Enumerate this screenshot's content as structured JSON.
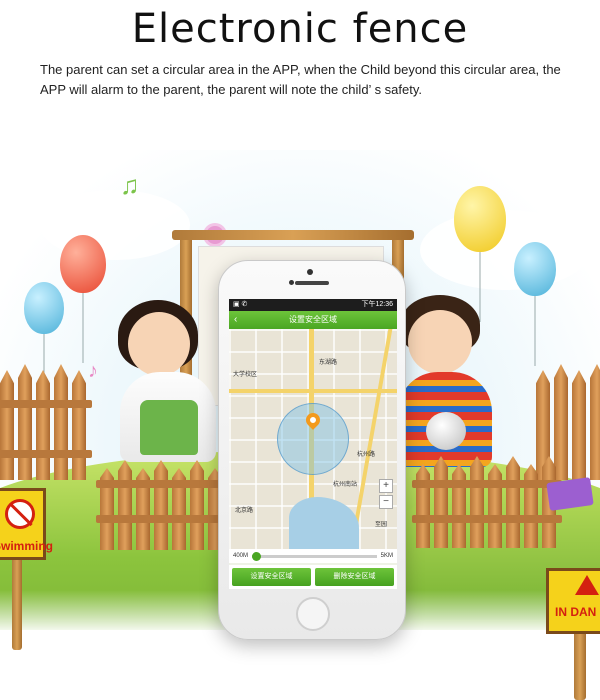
{
  "header": {
    "title": "Electronic  fence",
    "description": "The parent can set a circular area in the APP, when the Child beyond this circular area, the APP will alarm to the parent, the parent will note the child’  s safety."
  },
  "phone": {
    "status_time": "下午12:36",
    "screen_title": "设置安全区域",
    "radius_min": "400M",
    "radius_max": "5KM",
    "slider_value": 0.0,
    "btn_set": "设置安全区域",
    "btn_delete": "删除安全区域",
    "map_labels": [
      "北京路",
      "大学校区",
      "杭州南站",
      "东湖路",
      "至园",
      "杭州路"
    ],
    "zoom_in": "+",
    "zoom_out": "−"
  },
  "signs": {
    "left_label": "Swimming",
    "right_label": "IN DAN"
  },
  "colors": {
    "app_green": "#4aa623",
    "sign_yellow": "#f5d21b",
    "warning_red": "#d42010",
    "fence_brown": "#c8843f"
  }
}
